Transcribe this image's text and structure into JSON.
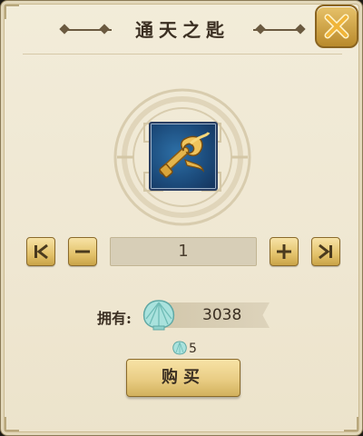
{
  "dialog": {
    "title": "通天之匙",
    "close_icon": "close-x-icon"
  },
  "item": {
    "icon": "golden-key-icon"
  },
  "quantity": {
    "value": "1",
    "first_icon": "skip-to-first-icon",
    "minus_icon": "minus-icon",
    "plus_icon": "plus-icon",
    "last_icon": "skip-to-last-icon"
  },
  "currency": {
    "owned_label": "拥有:",
    "owned_value": "3038",
    "icon": "shell-currency-icon",
    "price": "5"
  },
  "buy_button": {
    "label": "购买"
  },
  "colors": {
    "accent_gold": "#e3c26b",
    "panel_bg": "#efe7d2",
    "item_bg": "#1b4a7a",
    "text_dark": "#3b2f22"
  }
}
